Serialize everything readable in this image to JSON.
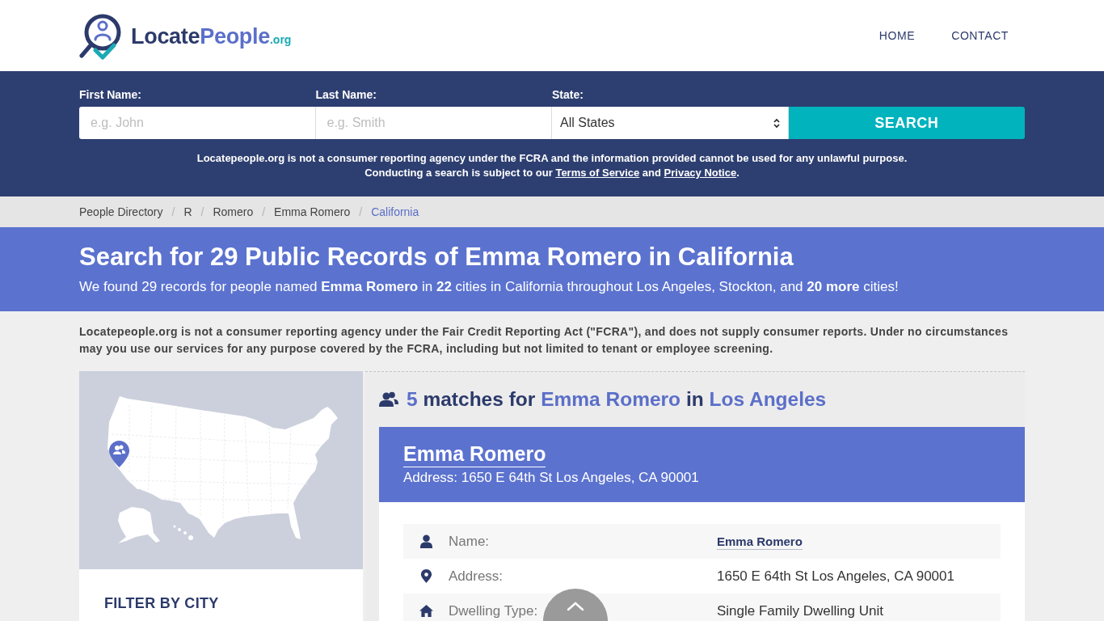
{
  "header": {
    "logo": [
      {
        "kind": "main",
        "text": "Locate"
      },
      {
        "kind": "accent",
        "text": "People"
      },
      {
        "kind": "suffix",
        "text": ".org"
      }
    ],
    "nav": [
      "HOME",
      "CONTACT"
    ]
  },
  "search": {
    "fields": [
      {
        "kind": "text",
        "label": "First Name:",
        "placeholder": "e.g. John"
      },
      {
        "kind": "text",
        "label": "Last Name:",
        "placeholder": "e.g. Smith"
      },
      {
        "kind": "select",
        "label": "State:",
        "value": "All States"
      }
    ],
    "button": "SEARCH",
    "notice": "Locatepeople.org is not a consumer reporting agency under the FCRA and the information provided cannot be used for any unlawful purpose.",
    "terms": [
      {
        "kind": "text",
        "text": "Conducting a search is subject to our "
      },
      {
        "kind": "link",
        "text": "Terms of Service"
      },
      {
        "kind": "text",
        "text": " and "
      },
      {
        "kind": "link",
        "text": "Privacy Notice"
      },
      {
        "kind": "text",
        "text": "."
      }
    ]
  },
  "breadcrumb": {
    "separator": "/",
    "items": [
      {
        "label": "People Directory",
        "selected": false
      },
      {
        "label": "R",
        "selected": false
      },
      {
        "label": "Romero",
        "selected": false
      },
      {
        "label": "Emma Romero",
        "selected": false
      },
      {
        "label": "California",
        "selected": true
      }
    ]
  },
  "hero": {
    "title": "Search for 29 Public Records of Emma Romero in California",
    "subtitle": "We found 29 records for people named **Emma Romero** in **22** cities in California throughout Los Angeles, Stockton, and **20 more** cities!"
  },
  "disclaimer": "Locatepeople.org is not a consumer reporting agency under the Fair Credit Reporting Act (\"FCRA\"), and does not supply consumer reports. Under no circumstances may you use our services for any purpose covered by the FCRA, including but not limited to tenant or employee screening.",
  "sidebar": {
    "filter_title": "FILTER BY CITY"
  },
  "results": {
    "heading": [
      {
        "kind": "accent",
        "text": "5"
      },
      {
        "kind": "plain",
        "text": "matches for"
      },
      {
        "kind": "accent",
        "text": "Emma Romero"
      },
      {
        "kind": "plain",
        "text": "in"
      },
      {
        "kind": "accent",
        "text": "Los Angeles"
      }
    ],
    "card": {
      "name": "Emma Romero",
      "address": "Address: 1650 E 64th St Los Angeles, CA 90001",
      "details": [
        {
          "kind": "person",
          "label": "Name:",
          "value": "Emma Romero",
          "link": true
        },
        {
          "kind": "location",
          "label": "Address:",
          "value": "1650 E 64th St Los Angeles, CA 90001",
          "link": false
        },
        {
          "kind": "home",
          "label": "Dwelling Type:",
          "value": "Single Family Dwelling Unit",
          "link": false
        }
      ]
    }
  }
}
